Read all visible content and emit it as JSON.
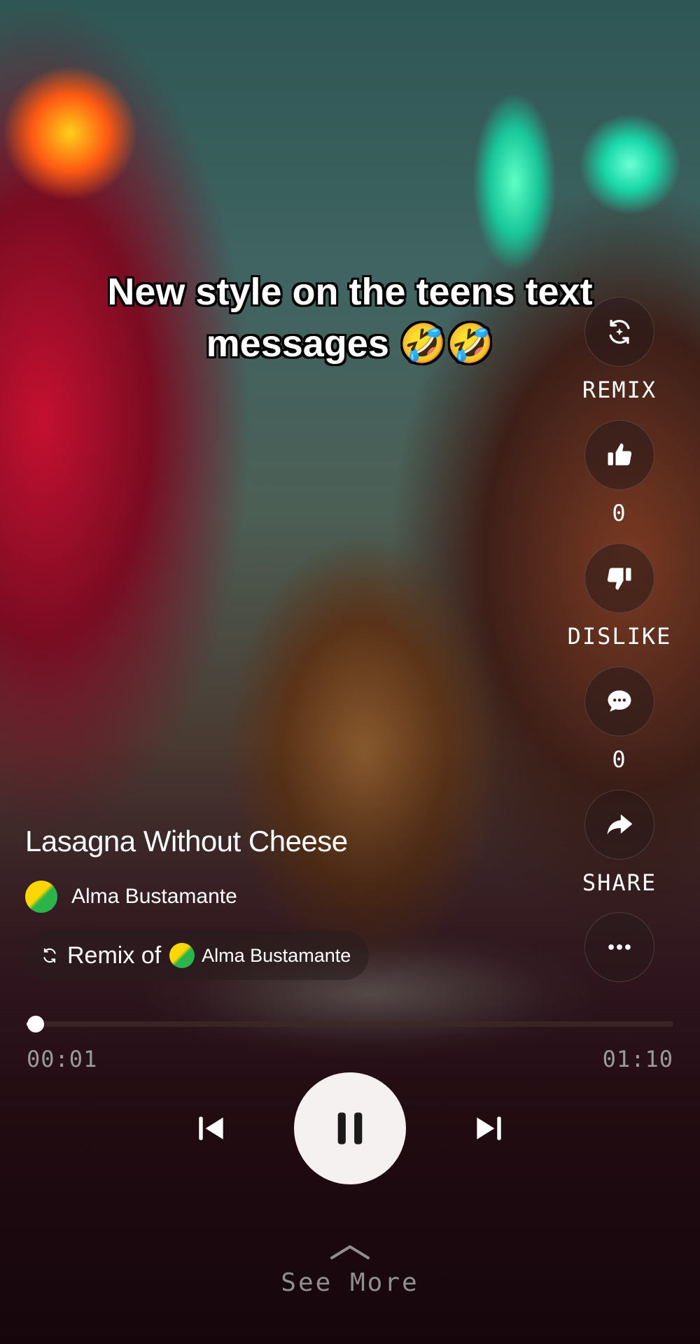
{
  "caption": {
    "line1": "New style on the teens text",
    "line2": "messages 🤣🤣"
  },
  "side_actions": {
    "remix": {
      "label": "REMIX",
      "icon": "remix-icon"
    },
    "like": {
      "count": "0",
      "icon": "thumbs-up-icon"
    },
    "dislike": {
      "label": "DISLIKE",
      "icon": "thumbs-down-icon"
    },
    "comment": {
      "count": "0",
      "icon": "comment-icon"
    },
    "share": {
      "label": "SHARE",
      "icon": "share-icon"
    },
    "more": {
      "icon": "more-icon"
    }
  },
  "song": {
    "title": "Lasagna Without Cheese",
    "author": "Alma Bustamante"
  },
  "remix": {
    "prefix": "Remix of",
    "author": "Alma Bustamante"
  },
  "player": {
    "elapsed": "00:01",
    "duration": "01:10",
    "progress_fraction": 0.014,
    "state": "playing"
  },
  "footer": {
    "see_more": "See More"
  },
  "colors": {
    "accent_white": "#f6f1f1",
    "muted_text": "#9a9a9a"
  }
}
